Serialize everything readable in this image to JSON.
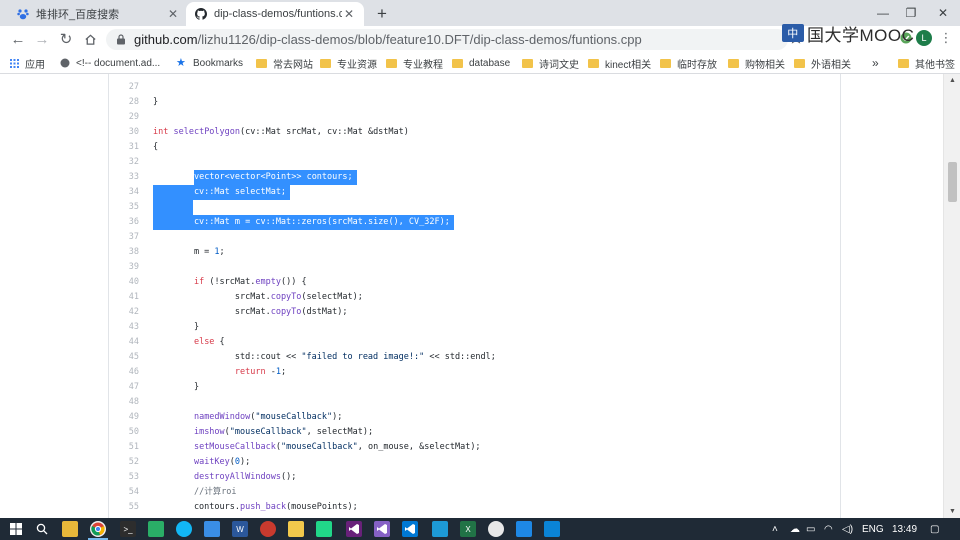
{
  "tabs": [
    {
      "title": "堆排环_百度搜索",
      "icon": "baidu-icon"
    },
    {
      "title": "dip-class-demos/funtions.cpp",
      "icon": "github-icon"
    }
  ],
  "toolbar": {
    "url_host": "github.com",
    "url_path": "/lizhu1126/dip-class-demos/blob/feature10.DFT/dip-class-demos/funtions.cpp",
    "watermark": "国大学MOOC",
    "watermark_mark": "中",
    "profile_initial": "L"
  },
  "bookmarks": [
    {
      "label": "应用",
      "icon": "apps-grid-icon"
    },
    {
      "label": "<!-- document.ad...",
      "icon": "globe-icon"
    },
    {
      "label": "Bookmarks",
      "icon": "star-icon"
    },
    {
      "label": "常去网站",
      "icon": "folder-icon"
    },
    {
      "label": "专业资源",
      "icon": "folder-icon"
    },
    {
      "label": "专业教程",
      "icon": "folder-icon"
    },
    {
      "label": "database",
      "icon": "folder-icon"
    },
    {
      "label": "诗词文史",
      "icon": "folder-icon"
    },
    {
      "label": "kinect相关",
      "icon": "folder-icon"
    },
    {
      "label": "临时存放",
      "icon": "folder-icon"
    },
    {
      "label": "购物相关",
      "icon": "folder-icon"
    },
    {
      "label": "外语相关",
      "icon": "folder-icon"
    },
    {
      "label": "»",
      "icon": "overflow-chevron-icon"
    },
    {
      "label": "其他书签",
      "icon": "folder-icon"
    }
  ],
  "code_lines": [
    {
      "n": "27",
      "text": "",
      "hl": false
    },
    {
      "n": "28",
      "text": "}",
      "hl": false
    },
    {
      "n": "29",
      "text": "",
      "hl": false
    },
    {
      "n": "30",
      "text": "int selectPolygon(cv::Mat srcMat, cv::Mat &dstMat)",
      "hl": false
    },
    {
      "n": "31",
      "text": "{",
      "hl": false
    },
    {
      "n": "32",
      "text": "",
      "hl": false
    },
    {
      "n": "33",
      "text": "        vector<vector<Point>> contours;",
      "hl": true
    },
    {
      "n": "34",
      "text": "        cv::Mat selectMat;",
      "hl": true
    },
    {
      "n": "35",
      "text": "",
      "hl": true
    },
    {
      "n": "36",
      "text": "        cv::Mat m = cv::Mat::zeros(srcMat.size(), CV_32F);",
      "hl": true
    },
    {
      "n": "37",
      "text": "",
      "hl": false
    },
    {
      "n": "38",
      "text": "        m = 1;",
      "hl": false
    },
    {
      "n": "39",
      "text": "",
      "hl": false
    },
    {
      "n": "40",
      "text": "        if (!srcMat.empty()) {",
      "hl": false
    },
    {
      "n": "41",
      "text": "                srcMat.copyTo(selectMat);",
      "hl": false
    },
    {
      "n": "42",
      "text": "                srcMat.copyTo(dstMat);",
      "hl": false
    },
    {
      "n": "43",
      "text": "        }",
      "hl": false
    },
    {
      "n": "44",
      "text": "        else {",
      "hl": false
    },
    {
      "n": "45",
      "text": "                std::cout << \"failed to read image!:\" << std::endl;",
      "hl": false
    },
    {
      "n": "46",
      "text": "                return -1;",
      "hl": false
    },
    {
      "n": "47",
      "text": "        }",
      "hl": false
    },
    {
      "n": "48",
      "text": "",
      "hl": false
    },
    {
      "n": "49",
      "text": "        namedWindow(\"mouseCallback\");",
      "hl": false
    },
    {
      "n": "50",
      "text": "        imshow(\"mouseCallback\", selectMat);",
      "hl": false
    },
    {
      "n": "51",
      "text": "        setMouseCallback(\"mouseCallback\", on_mouse, &selectMat);",
      "hl": false
    },
    {
      "n": "52",
      "text": "        waitKey(0);",
      "hl": false
    },
    {
      "n": "53",
      "text": "        destroyAllWindows();",
      "hl": false
    },
    {
      "n": "54",
      "text": "        //计算roi",
      "hl": false
    },
    {
      "n": "55",
      "text": "        contours.push_back(mousePoints);",
      "hl": false
    }
  ],
  "syntax_colors": {
    "keyword": "#d73a49",
    "function": "#6f42c1",
    "string": "#032f62",
    "number": "#005cc5",
    "comment": "#6a737d",
    "selection": "#3390ff"
  },
  "taskbar": {
    "apps": [
      "start-windows-icon",
      "search-icon",
      "file-explorer-icon",
      "chrome-icon",
      "terminal-icon",
      "wechat-icon",
      "qq-icon",
      "photo-icon",
      "word-icon",
      "wps-icon",
      "notes-icon",
      "pycharm-icon",
      "visual-studio-icon",
      "visual-studio-purple-icon",
      "vscode-icon",
      "excel-icon",
      "sogou-icon",
      "video-icon",
      "capture-icon"
    ],
    "language": "ENG",
    "time": "13:49"
  }
}
